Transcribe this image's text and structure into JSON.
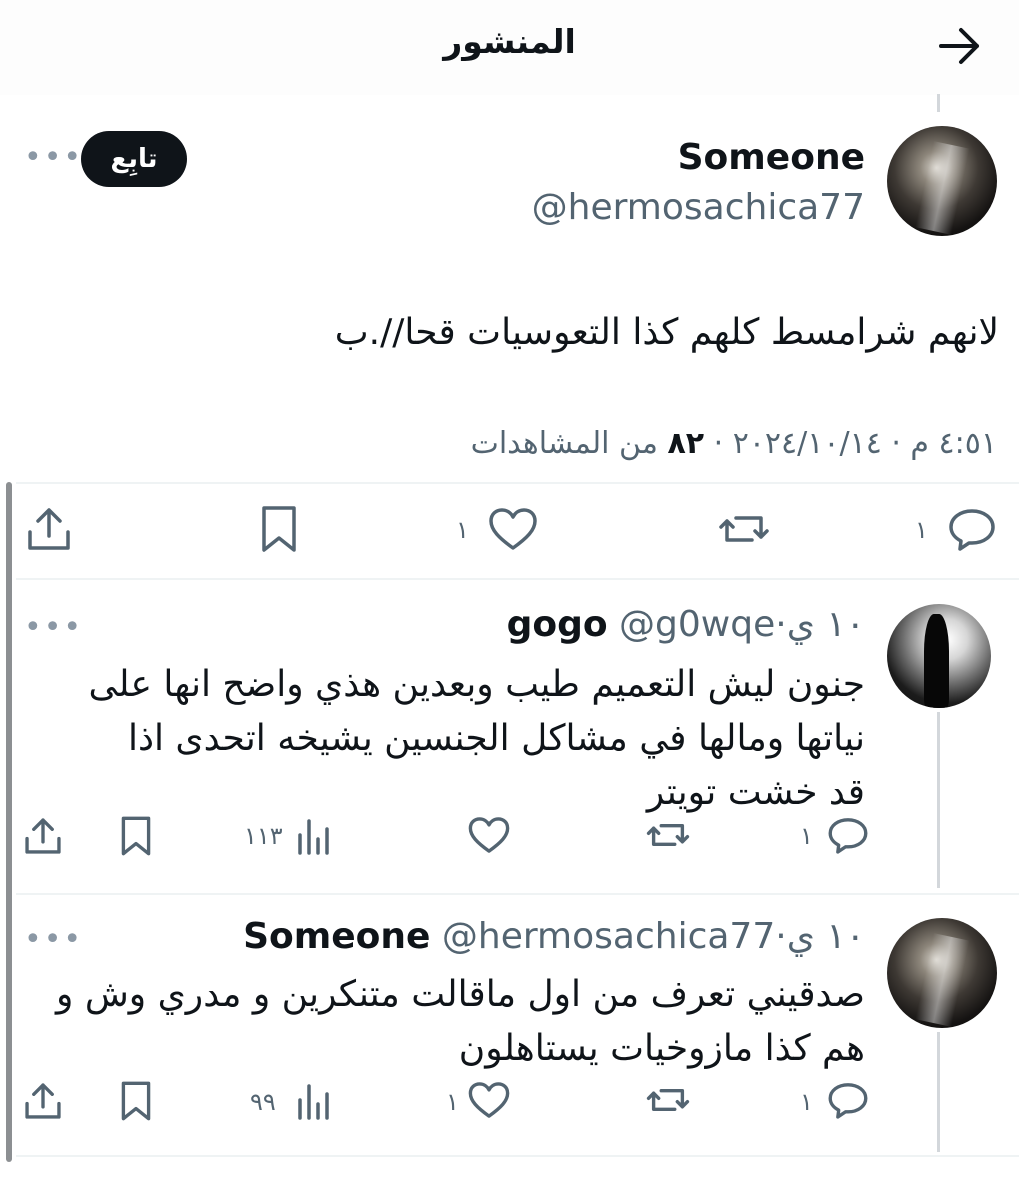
{
  "header": {
    "title": "المنشور",
    "back_icon": "arrow-right-icon"
  },
  "main_post": {
    "author_name": "Someone",
    "author_handle": "@hermosachica77",
    "follow_label": "تابِع",
    "more_icon": "more-dots-icon",
    "text": "لانهم شرامسط كلهم كذا التعوسيات قحا//.ب",
    "timestamp": "٤:٥١ م · ٢٠٢٤/١٠/١٤",
    "views_count": "٨٢",
    "views_label": "من المشاهدات",
    "actions": {
      "reply_count": "١",
      "repost_count": "",
      "like_count": "١"
    }
  },
  "replies": [
    {
      "author_name": "gogo",
      "author_handle": "@g0wqe",
      "time": "١٠ ي",
      "text": "جنون ليش التعميم طيب وبعدين هذي واضح انها على نياتها ومالها في مشاكل الجنسين يشيخه اتحدى اذا قد خشت تويتر",
      "reply_count": "١",
      "repost_count": "",
      "like_count": "",
      "views_count": "١١٣"
    },
    {
      "author_name": "Someone",
      "author_handle": "@hermosachica77",
      "time": "١٠ ي",
      "text": "صدقيني تعرف من اول ماقالت متنكرين و مدري وش و هم كذا مازوخيات يستاهلون",
      "reply_count": "١",
      "repost_count": "",
      "like_count": "١",
      "views_count": "٩٩"
    }
  ],
  "colors": {
    "text": "#0f1419",
    "secondary": "#536471",
    "button_bg": "#0f1419",
    "divider": "#eff3f4"
  }
}
